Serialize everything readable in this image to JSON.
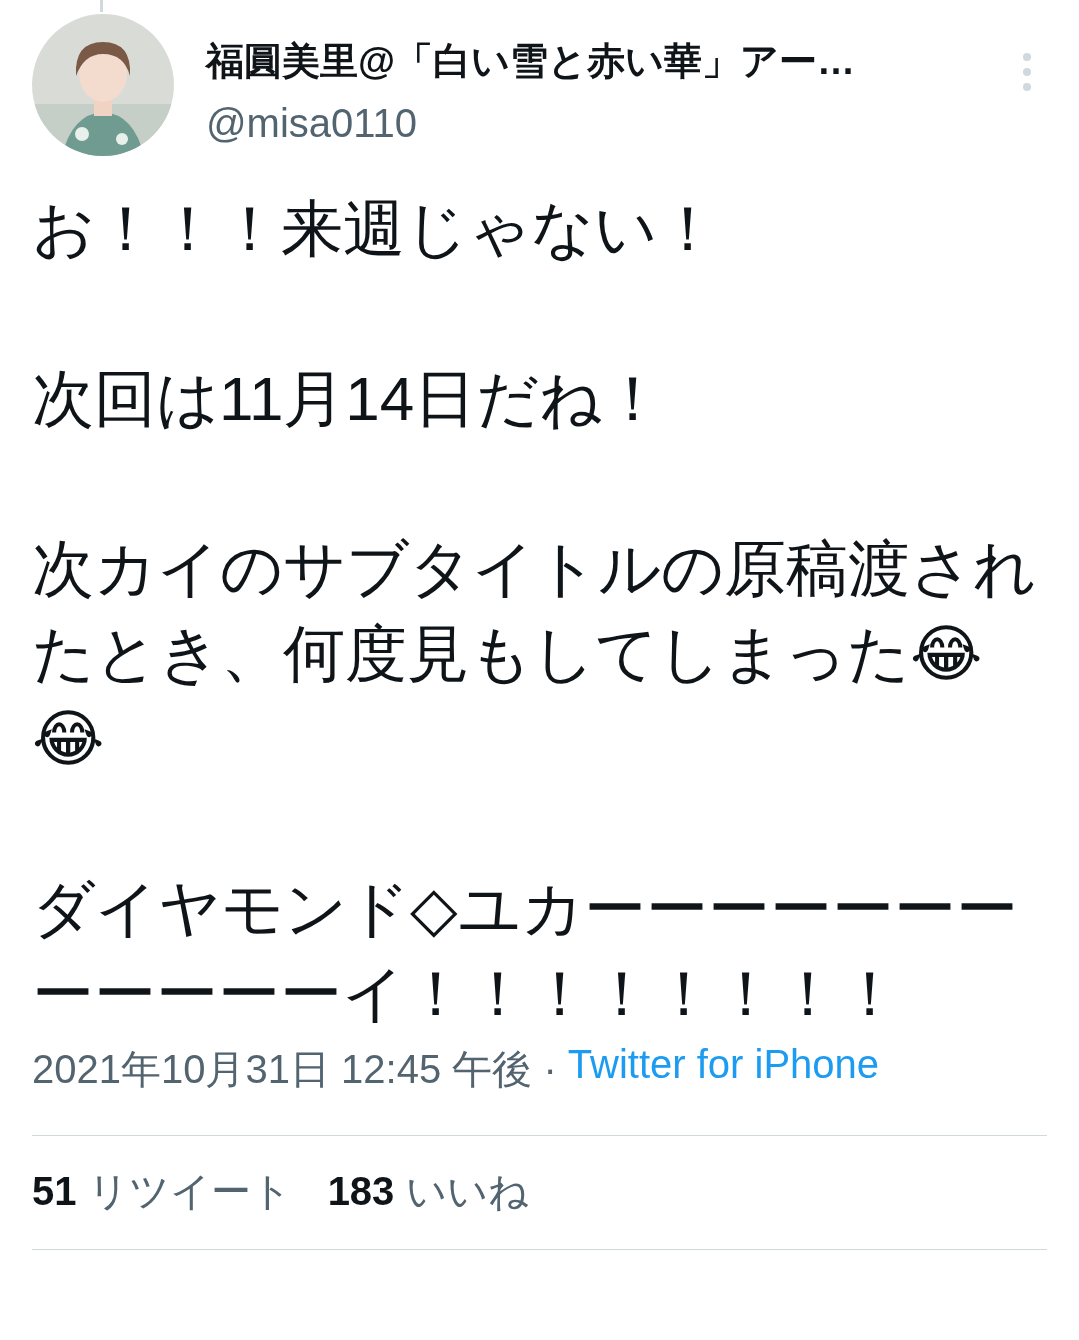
{
  "author": {
    "name": "福圓美里@「白い雪と赤い華」アー…",
    "handle": "@misa0110"
  },
  "body": [
    "お！！！来週じゃない！",
    "次回は11月14日だね！",
    "次カイのサブタイトルの原稿渡されたとき、何度見もしてしまった😂😂",
    "ダイヤモンド◇ユカーーーーーーーーーーーーイ！！！！！！！！"
  ],
  "meta": {
    "timestamp": "2021年10月31日 12:45 午後 · ",
    "source": "Twitter for iPhone"
  },
  "stats": [
    {
      "count": "51",
      "label": "リツイート"
    },
    {
      "count": "183",
      "label": "いいね"
    }
  ]
}
